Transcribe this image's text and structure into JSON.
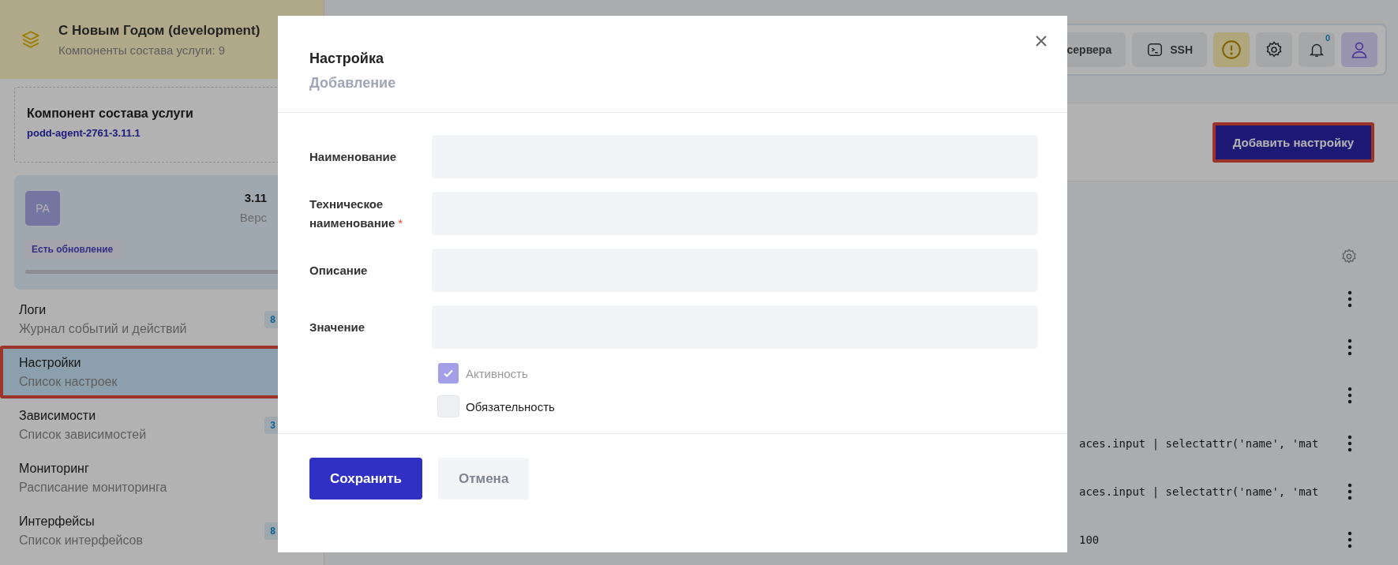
{
  "sidebar": {
    "project": {
      "title": "С Новым Годом (development)",
      "subtitle": "Компоненты состава услуги: 9"
    },
    "component": {
      "label": "Компонент состава услуги",
      "value": "podd-agent-2761-3.11.1"
    },
    "version_card": {
      "avatar": "PA",
      "version": "3.11",
      "version_label": "Верс",
      "badge": "Есть обновление"
    },
    "nav": [
      {
        "title": "Логи",
        "subtitle": "Журнал событий и действий",
        "count": "8",
        "selected": false
      },
      {
        "title": "Настройки",
        "subtitle": "Список настроек",
        "selected": true
      },
      {
        "title": "Зависимости",
        "subtitle": "Список зависимостей",
        "count": "3",
        "selected": false
      },
      {
        "title": "Мониторинг",
        "subtitle": "Расписание мониторинга",
        "selected": false
      },
      {
        "title": "Интерфейсы",
        "subtitle": "Список интерфейсов",
        "count": "8",
        "selected": false
      }
    ]
  },
  "toolbar": {
    "buttons": [
      {
        "kind": "text",
        "label": "сервера"
      },
      {
        "kind": "ssh",
        "label": "SSH"
      },
      {
        "kind": "alert"
      },
      {
        "kind": "settings"
      },
      {
        "kind": "notifications",
        "count": "0"
      },
      {
        "kind": "user"
      }
    ]
  },
  "page": {
    "add_button": "Добавить настройку",
    "rows": [
      {
        "kind": "empty"
      },
      {
        "kind": "empty"
      },
      {
        "kind": "empty"
      },
      {
        "kind": "code",
        "value": "aces.input | selectattr('name', 'mat"
      },
      {
        "kind": "code",
        "value": "aces.input | selectattr('name', 'mat"
      },
      {
        "kind": "number",
        "value": "100"
      }
    ]
  },
  "modal": {
    "title": "Настройка",
    "subtitle": "Добавление",
    "fields": [
      {
        "label": "Наименование"
      },
      {
        "label": "Техническое наименование",
        "required_mark": "*"
      },
      {
        "label": "Описание"
      },
      {
        "label": "Значение"
      }
    ],
    "checkboxes": [
      {
        "label": "Активность",
        "checked": true,
        "disabled": true
      },
      {
        "label": "Обязательность",
        "checked": false,
        "disabled": false
      }
    ],
    "buttons": [
      {
        "kind": "primary",
        "label": "Сохранить"
      },
      {
        "kind": "secondary",
        "label": "Отмена"
      }
    ]
  }
}
